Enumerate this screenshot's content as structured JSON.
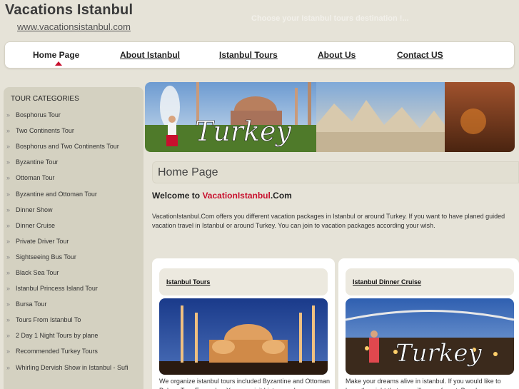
{
  "header": {
    "title": "Vacations Istanbul",
    "url": "www.vacationsistanbul.com",
    "tagline": "Choose your Istanbul tours destination !..."
  },
  "nav": {
    "items": [
      {
        "label": "Home Page"
      },
      {
        "label": "About Istanbul"
      },
      {
        "label": "Istanbul Tours"
      },
      {
        "label": "About Us"
      },
      {
        "label": "Contact US"
      }
    ]
  },
  "sidebar": {
    "title": "TOUR CATEGORIES",
    "items": [
      {
        "label": "Bosphorus Tour"
      },
      {
        "label": "Two Continents Tour"
      },
      {
        "label": "Bosphorus and Two Continents Tour"
      },
      {
        "label": "Byzantine Tour"
      },
      {
        "label": "Ottoman Tour"
      },
      {
        "label": "Byzantine and Ottoman Tour"
      },
      {
        "label": "Dinner Show"
      },
      {
        "label": "Dinner Cruise"
      },
      {
        "label": "Private Driver Tour"
      },
      {
        "label": "Sightseeing Bus Tour"
      },
      {
        "label": "Black Sea Tour"
      },
      {
        "label": "Istanbul Princess Island Tour"
      },
      {
        "label": "Bursa Tour"
      },
      {
        "label": "Tours From Istanbul To"
      },
      {
        "label": "2 Day 1 Night Tours by plane"
      },
      {
        "label": "Recommended Turkey Tours"
      },
      {
        "label": "Whirling Dervish Show in Istanbul - Sufi"
      }
    ]
  },
  "banner": {
    "script_text": "Turkey"
  },
  "main": {
    "heading": "Home Page",
    "welcome_prefix": "Welcome to ",
    "welcome_red": "Vacation",
    "welcome_mid": "Istanbul",
    "welcome_suffix": ".Com",
    "intro": "VacationIstanbul.Com offers you different vacation packages in Istanbul or around Turkey. If you want to have planed guided vacation travel in Istanbul or around Turkey. You can join to vacation packages according your wish."
  },
  "cards": [
    {
      "title": "Istanbul Tours",
      "text": "We organize istanbul tours included Byzantine and Ottoman Palace Tour Every day. You can visit history and"
    },
    {
      "title": "Istanbul Dinner Cruise",
      "text": "Make your dreams alive in istanbul. If you would like to have the night that you will never forget. Bosphorus"
    }
  ],
  "colors": {
    "accent_red": "#c8102e",
    "sidebar_bg": "#d4d1c1",
    "page_bg": "#e6e3d8"
  }
}
